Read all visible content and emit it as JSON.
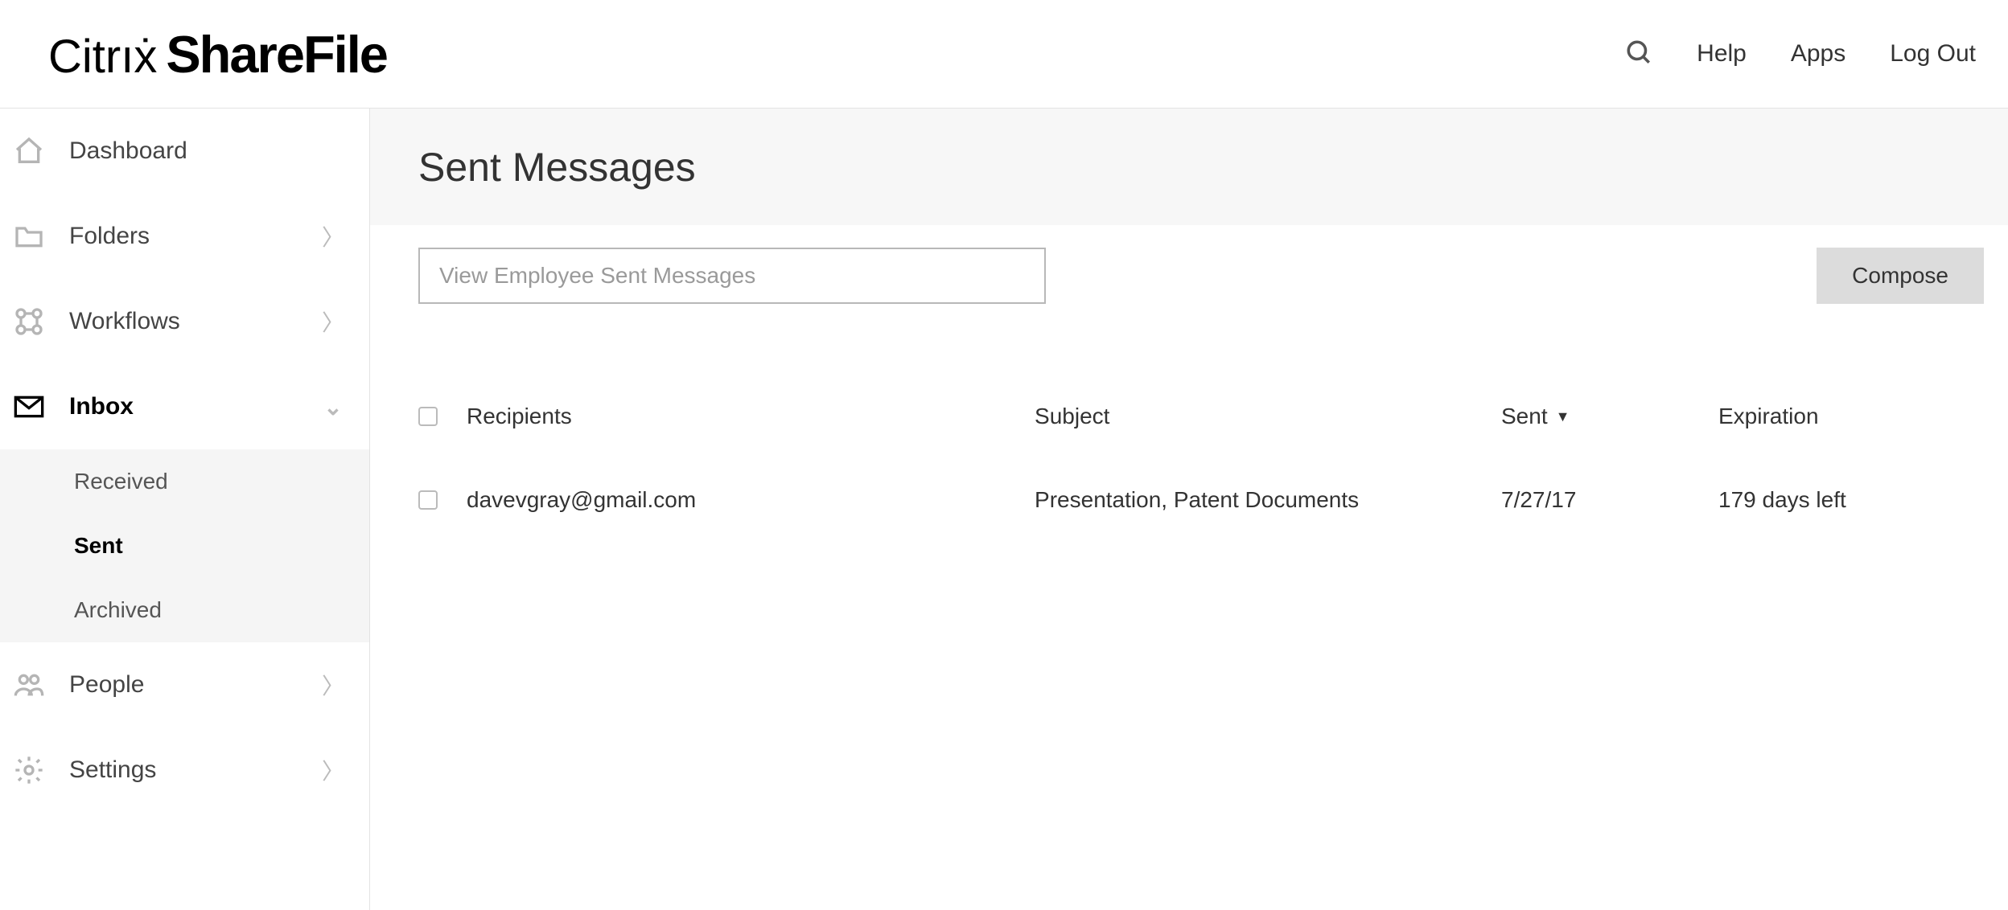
{
  "brand": {
    "left": "Citrıẋ",
    "right": "ShareFile"
  },
  "topnav": {
    "help": "Help",
    "apps": "Apps",
    "logout": "Log Out"
  },
  "sidebar": {
    "dashboard": "Dashboard",
    "folders": "Folders",
    "workflows": "Workflows",
    "inbox": "Inbox",
    "inbox_items": {
      "received": "Received",
      "sent": "Sent",
      "archived": "Archived"
    },
    "people": "People",
    "settings": "Settings"
  },
  "page": {
    "title": "Sent Messages",
    "search_placeholder": "View Employee Sent Messages",
    "compose": "Compose"
  },
  "table": {
    "headers": {
      "recipients": "Recipients",
      "subject": "Subject",
      "sent": "Sent",
      "expiration": "Expiration"
    },
    "rows": [
      {
        "recipients": "davevgray@gmail.com",
        "subject": "Presentation, Patent Documents",
        "sent": "7/27/17",
        "expiration": "179 days left"
      }
    ]
  }
}
